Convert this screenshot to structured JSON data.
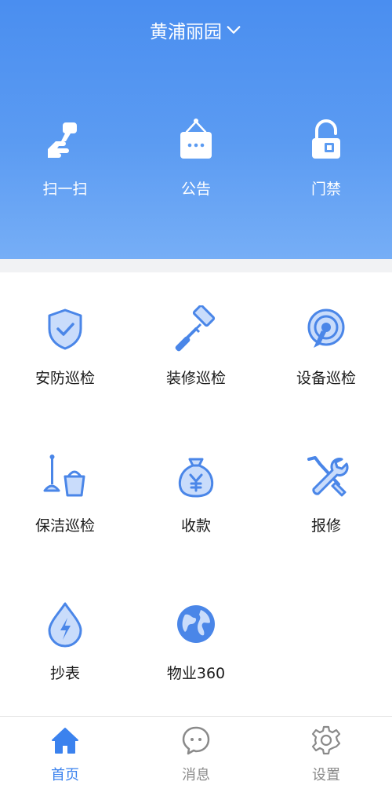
{
  "header": {
    "community_name": "黄浦丽园"
  },
  "quick_actions": [
    {
      "label": "扫一扫",
      "icon": "scan-hand-icon"
    },
    {
      "label": "公告",
      "icon": "announcement-board-icon"
    },
    {
      "label": "门禁",
      "icon": "access-lock-icon"
    }
  ],
  "services": [
    {
      "label": "安防巡检",
      "icon": "shield-check-icon"
    },
    {
      "label": "装修巡检",
      "icon": "paint-roller-icon"
    },
    {
      "label": "设备巡检",
      "icon": "signal-device-icon"
    },
    {
      "label": "保洁巡检",
      "icon": "mop-bucket-icon"
    },
    {
      "label": "收款",
      "icon": "money-bag-icon"
    },
    {
      "label": "报修",
      "icon": "wrench-screwdriver-icon"
    },
    {
      "label": "抄表",
      "icon": "energy-drop-icon"
    },
    {
      "label": "物业360",
      "icon": "globe-icon"
    }
  ],
  "tabs": [
    {
      "label": "首页",
      "icon": "home-icon",
      "active": true
    },
    {
      "label": "消息",
      "icon": "chat-bubble-icon",
      "active": false
    },
    {
      "label": "设置",
      "icon": "gear-icon",
      "active": false
    }
  ],
  "colors": {
    "accent": "#3b82ee",
    "header_top": "#4a8ef0",
    "header_bottom": "#76aef6",
    "icon_fill": "#4a86e8",
    "icon_light": "#c9dcfb",
    "tab_inactive": "#8a8a8a"
  }
}
